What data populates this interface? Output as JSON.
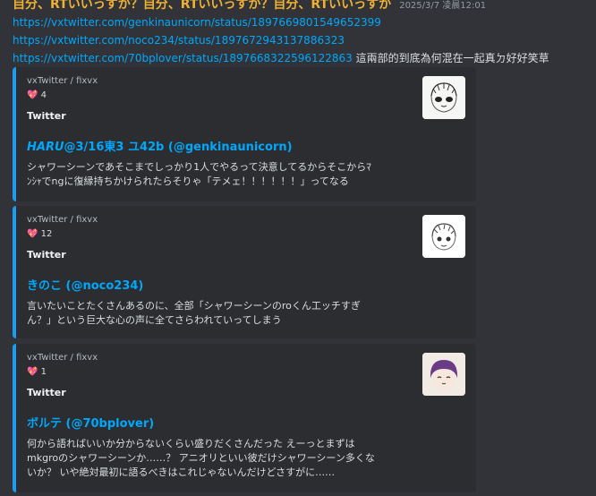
{
  "message": {
    "username": "自分、RTいいっすか？自分、RTいいっすか？自分、RTいいっすか",
    "timestamp": "2025/3/7 凌晨12:01",
    "links": [
      "https://vxtwitter.com/genkinaunicorn/status/1897669801549652399",
      "https://vxtwitter.com/noco234/status/1897672943137886323",
      "https://vxtwitter.com/70bplover/status/1897668322596122863"
    ],
    "trailing_text": " 這兩部的到底為何混在一起真ㄉ好好笑草"
  },
  "embeds": [
    {
      "provider": "vxTwitter / fixvx",
      "likes": "4",
      "title": "Twitter",
      "author_prefix": "HARU",
      "author_rest": "@3/16東3 ユ42b (@genkinaunicorn)",
      "desc_lines": [
        "シャワーシーンであそこまでしっかり1人でやるって決意してるからそこからﾏ",
        "ﾝｼｬでngに復縁持ちかけられたらそりゃ「テメェ！！！！！！」ってなる"
      ],
      "thumb_icon": "anime-avatar-icon"
    },
    {
      "provider": "vxTwitter / fixvx",
      "likes": "12",
      "title": "Twitter",
      "author_prefix": "",
      "author_rest": "きのこ (@noco234)",
      "desc_lines": [
        "言いたいことたくさんあるのに、全部「シャワーシーンのroくん工ッチすぎ",
        "ん？」という巨大な心の声に全てさらわれていってしまう"
      ],
      "thumb_icon": "sketch-avatar-icon"
    },
    {
      "provider": "vxTwitter / fixvx",
      "likes": "1",
      "title": "Twitter",
      "author_prefix": "",
      "author_rest": "ボルテ (@70bplover)",
      "desc_lines": [
        "何から語ればいいか分からないくらい盛りだくさんだった えーっとまずは",
        "mkgroのシャワーシーンか……？ アニオリといい彼だけシャワーシーン多くな",
        "いか？ いや絶対最初に語るべきはこれじゃないんだけどさすがに……"
      ],
      "thumb_icon": "purple-hair-avatar-icon"
    }
  ],
  "colors": {
    "accent": "#1d9bf0",
    "link": "#00a8fc",
    "username": "#f0b132",
    "heart": "#f23f43"
  }
}
